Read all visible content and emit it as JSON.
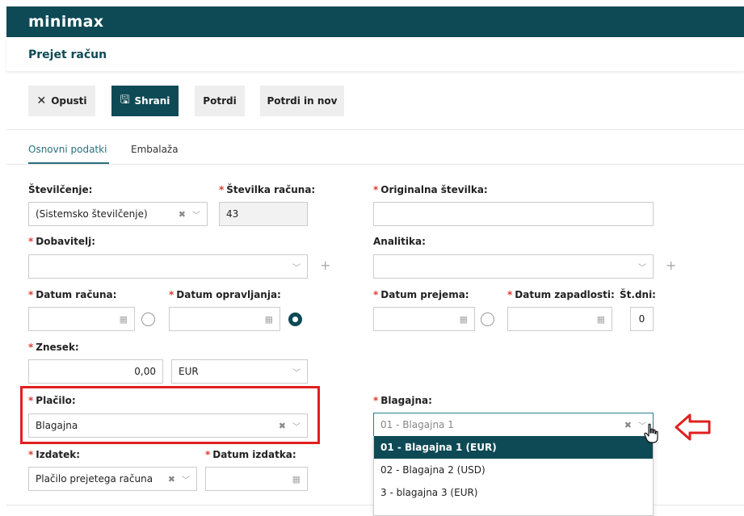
{
  "app": {
    "logo": "minimax"
  },
  "page": {
    "title": "Prejet račun"
  },
  "toolbar": {
    "discard_label": "Opusti",
    "save_label": "Shrani",
    "confirm_label": "Potrdi",
    "confirm_new_label": "Potrdi in nov"
  },
  "tabs": [
    {
      "label": "Osnovni podatki",
      "active": true
    },
    {
      "label": "Embalaža",
      "active": false
    }
  ],
  "form": {
    "numbering": {
      "label": "Številčenje:",
      "value": "(Sistemsko številčenje)"
    },
    "invoice_number": {
      "label": "Številka računa:",
      "value": "43"
    },
    "original_number": {
      "label": "Originalna številka:",
      "value": ""
    },
    "supplier": {
      "label": "Dobavitelj:",
      "value": ""
    },
    "analytics": {
      "label": "Analitika:",
      "value": ""
    },
    "invoice_date": {
      "label": "Datum računa:",
      "value": ""
    },
    "service_date": {
      "label": "Datum opravljanja:",
      "value": ""
    },
    "receipt_date": {
      "label": "Datum prejema:",
      "value": ""
    },
    "due_date": {
      "label": "Datum zapadlosti:",
      "value": ""
    },
    "days": {
      "label": "Št.dni:",
      "value": "0"
    },
    "amount": {
      "label": "Znesek:",
      "value": "0,00"
    },
    "currency": {
      "value": "EUR"
    },
    "payment": {
      "label": "Plačilo:",
      "value": "Blagajna"
    },
    "cash_register": {
      "label": "Blagajna:",
      "value": "01 - Blagajna 1"
    },
    "expense": {
      "label": "Izdatek:",
      "value": "Plačilo prejetega računa"
    },
    "expense_date": {
      "label": "Datum izdatka:",
      "value": ""
    }
  },
  "cash_register_options": [
    {
      "label": "01 - Blagajna 1 (EUR)",
      "selected": true
    },
    {
      "label": "02 - Blagajna 2 (USD)",
      "selected": false
    },
    {
      "label": "3 - blagajna 3 (EUR)",
      "selected": false
    }
  ],
  "icons": {
    "clear": "✖",
    "chevron": "﹀",
    "calendar": "▦",
    "plus": "+"
  },
  "colors": {
    "brand": "#0e4a55",
    "required": "#e03b2c",
    "annotation": "#e02020"
  }
}
